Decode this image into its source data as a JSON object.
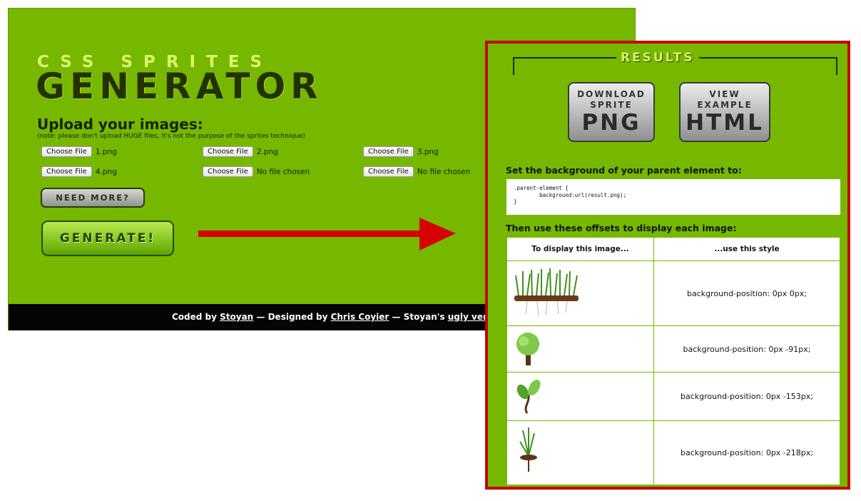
{
  "app": {
    "logo_top": "CSS SPRITES",
    "logo_main": "GENERATOR",
    "upload_heading": "Upload your images:",
    "upload_note": "(note: please don't upload HUGE files, it's not the purpose of the sprites technique)",
    "file_button_label": "Choose File",
    "files": [
      "1.png",
      "2.png",
      "3.png",
      "4.png",
      "No file chosen",
      "No file chosen"
    ],
    "need_more_label": "NEED MORE?",
    "generate_label": "GENERATE!",
    "footer": {
      "coded_by": "Coded by ",
      "stoyan": "Stoyan",
      "designed_by": " — Designed by ",
      "chris": "Chris Coyier",
      "stoyans": " — Stoyan's ",
      "ugly": "ugly version"
    }
  },
  "results": {
    "title": "RESULTS",
    "download": {
      "line1": "DOWNLOAD",
      "line2": "SPRITE",
      "big": "PNG"
    },
    "view": {
      "line1": "VIEW",
      "line2": "EXAMPLE",
      "big": "HTML"
    },
    "heading1": "Set the background of your parent element to:",
    "css_lines": [
      ".parent-element {",
      "        background:url(result.png);",
      "}"
    ],
    "heading2": "Then use these offsets to display each image:",
    "table": {
      "headers": [
        "To display this image...",
        "...use this style"
      ],
      "rows": [
        {
          "icon": "grass-image",
          "style": "background-position: 0px 0px;"
        },
        {
          "icon": "tree-image",
          "style": "background-position: 0px -91px;"
        },
        {
          "icon": "sprout-image",
          "style": "background-position: 0px -153px;"
        },
        {
          "icon": "plant-image",
          "style": "background-position: 0px -218px;"
        }
      ]
    }
  },
  "colors": {
    "panel_green": "#76b800",
    "highlight_red": "#c40000",
    "arrow_red": "#d60000",
    "footer_black": "#050505"
  }
}
